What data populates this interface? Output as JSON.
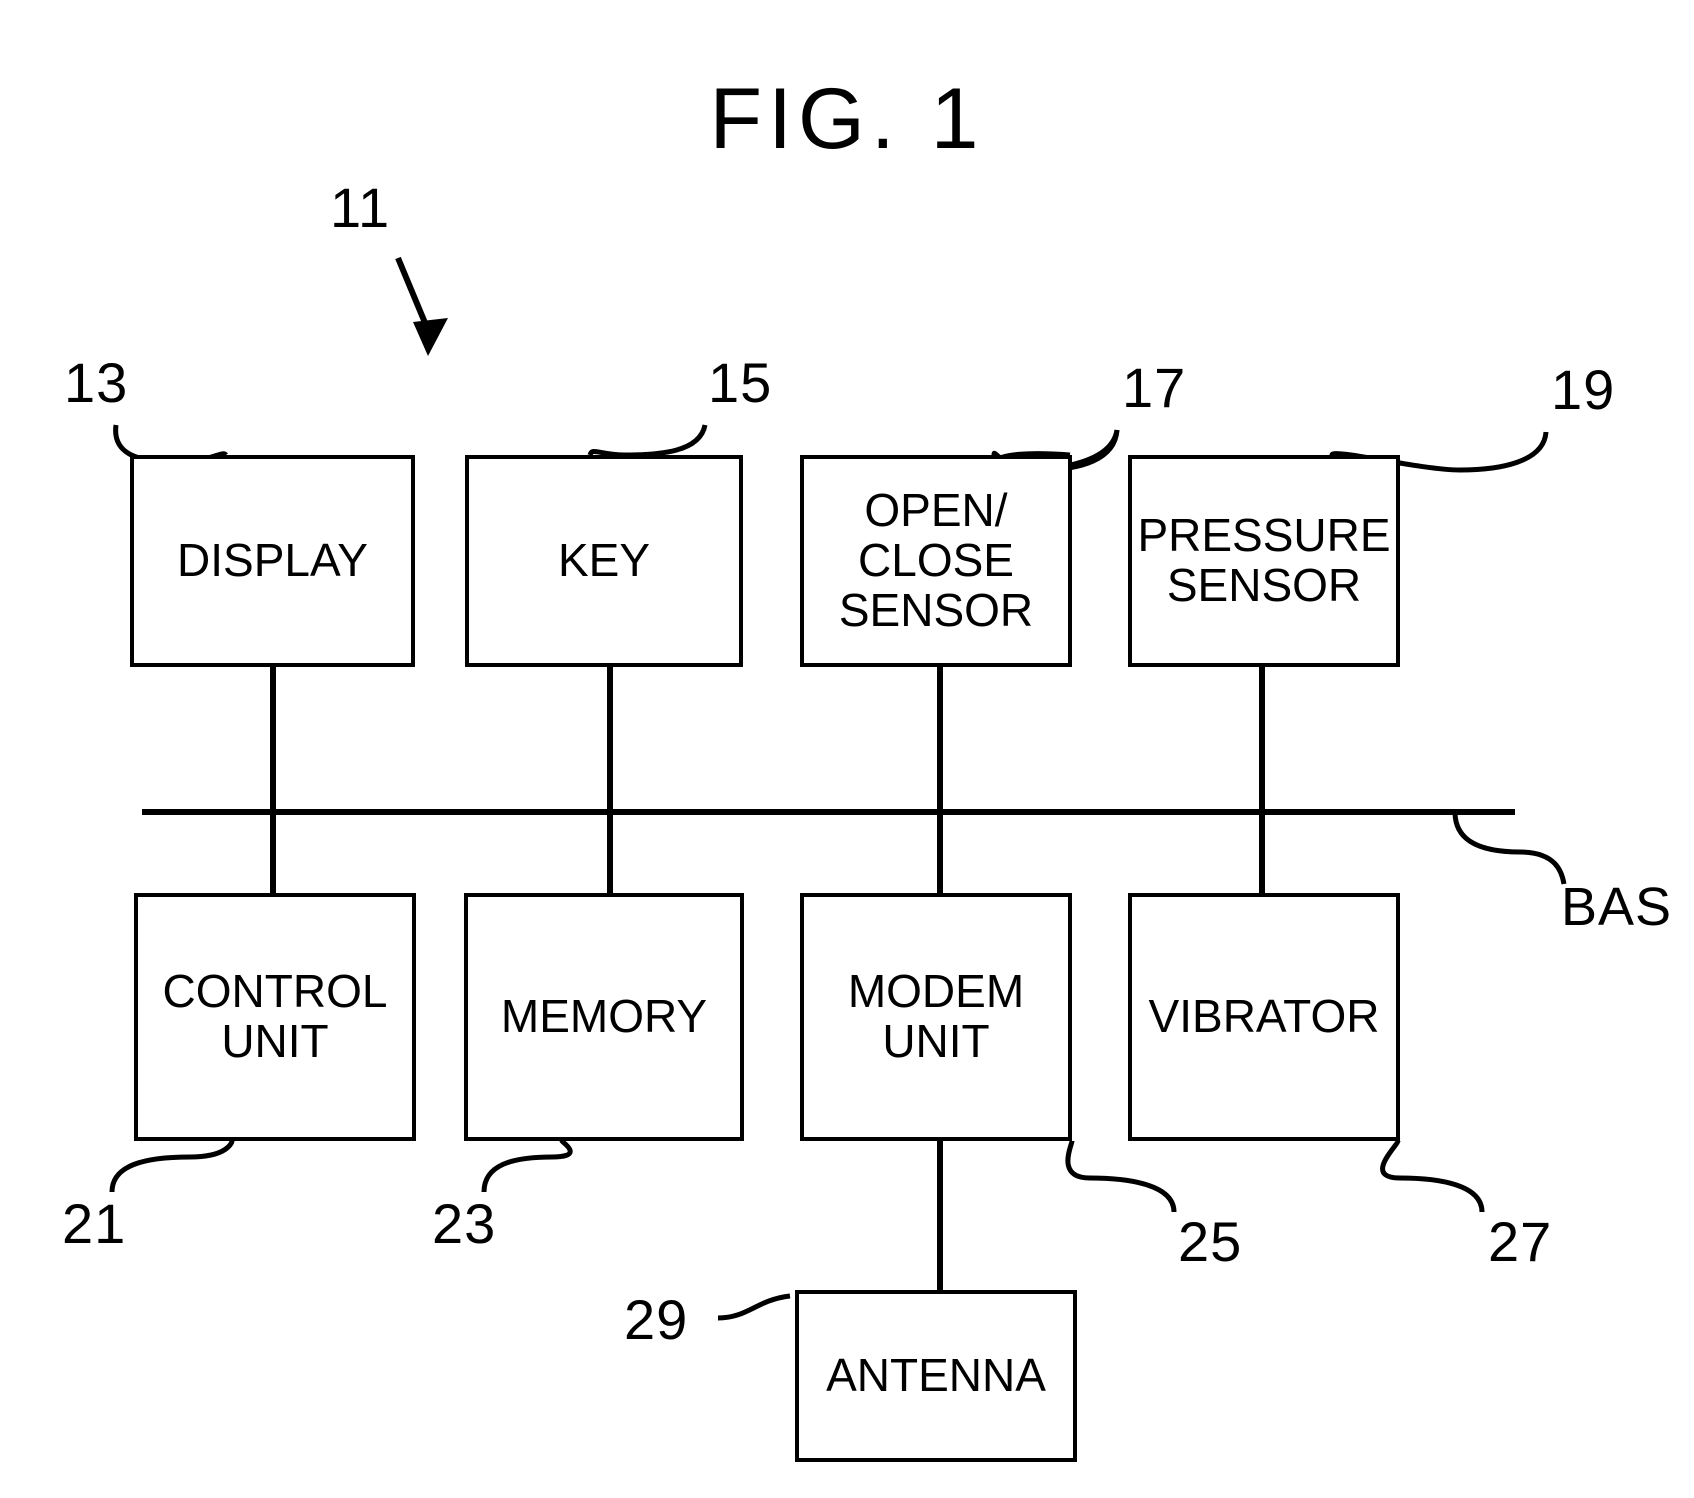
{
  "figure": {
    "title": "FIG.  1",
    "assembly_ref": "11",
    "bus_label": "BAS"
  },
  "blocks": [
    {
      "id": "display",
      "label": "DISPLAY",
      "ref": "13"
    },
    {
      "id": "key",
      "label": "KEY",
      "ref": "15"
    },
    {
      "id": "open_close",
      "label": "OPEN/\nCLOSE\nSENSOR",
      "ref": "17"
    },
    {
      "id": "pressure",
      "label": "PRESSURE\nSENSOR",
      "ref": "19"
    },
    {
      "id": "control_unit",
      "label": "CONTROL\nUNIT",
      "ref": "21"
    },
    {
      "id": "memory",
      "label": "MEMORY",
      "ref": "23"
    },
    {
      "id": "modem_unit",
      "label": "MODEM\nUNIT",
      "ref": "25"
    },
    {
      "id": "vibrator",
      "label": "VIBRATOR",
      "ref": "27"
    },
    {
      "id": "antenna",
      "label": "ANTENNA",
      "ref": "29"
    }
  ],
  "colors": {
    "line": "#000000",
    "background": "#ffffff"
  }
}
